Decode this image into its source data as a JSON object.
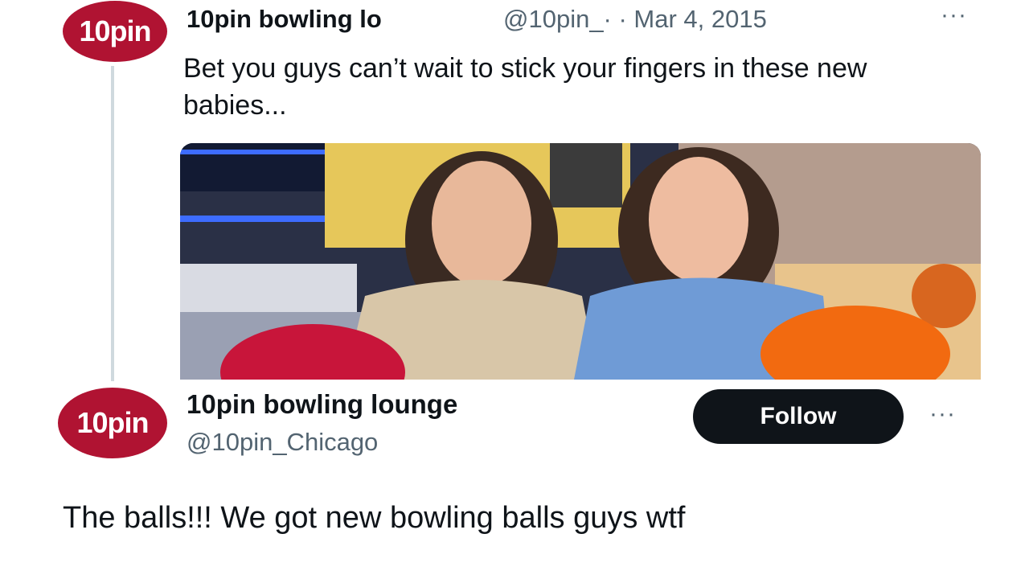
{
  "tweet1": {
    "avatar_text": "10pin",
    "display_name": "10pin bowling lo",
    "meta": "@10pin_· · Mar 4, 2015",
    "more": "···",
    "text": "Bet you guys can’t wait to stick your fingers in these new babies...",
    "media_icon": "photo-two-women-bowling-balls"
  },
  "tweet2": {
    "avatar_text": "10pin",
    "display_name": "10pin bowling lounge",
    "handle": "@10pin_Chicago",
    "follow_label": "Follow",
    "more": "···",
    "text": "The balls!!! We got new bowling balls guys wtf"
  },
  "colors": {
    "brand": "#b01332",
    "follow_bg": "#0f1419",
    "muted": "#536471"
  }
}
